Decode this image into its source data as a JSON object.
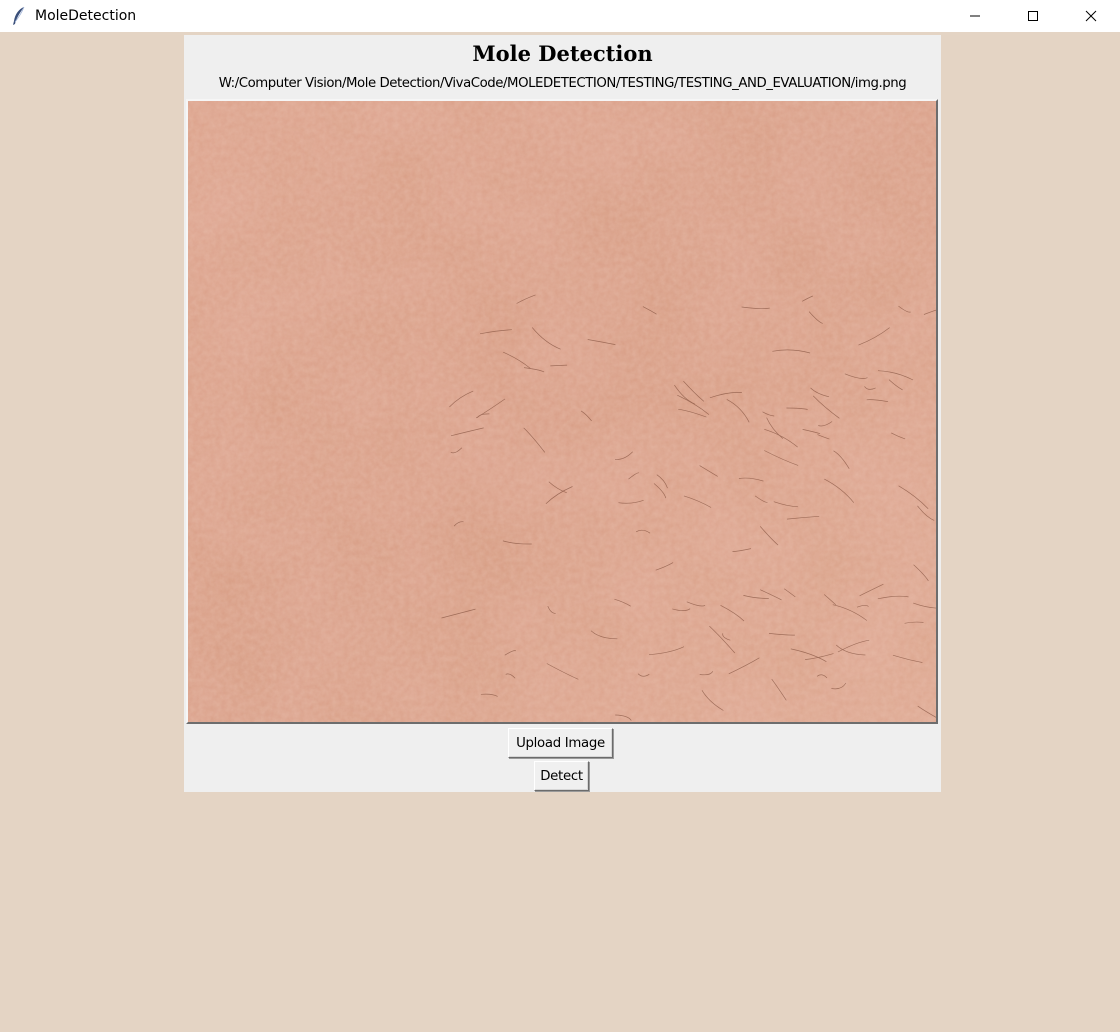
{
  "window": {
    "title": "MoleDetection",
    "controls": {
      "minimize": "minimize-icon",
      "maximize": "maximize-icon",
      "close": "close-icon"
    }
  },
  "app": {
    "heading": "Mole Detection",
    "file_path": "W:/Computer Vision/Mole Detection/VivaCode/MOLEDETECTION/TESTING/TESTING_AND_EVALUATION/img.png",
    "preview_icon": "skin-image"
  },
  "buttons": {
    "upload_label": "Upload Image",
    "detect_label": "Detect"
  },
  "colors": {
    "background": "#e4d4c4",
    "panel": "#efefef",
    "skin_base": "#d79b80"
  }
}
